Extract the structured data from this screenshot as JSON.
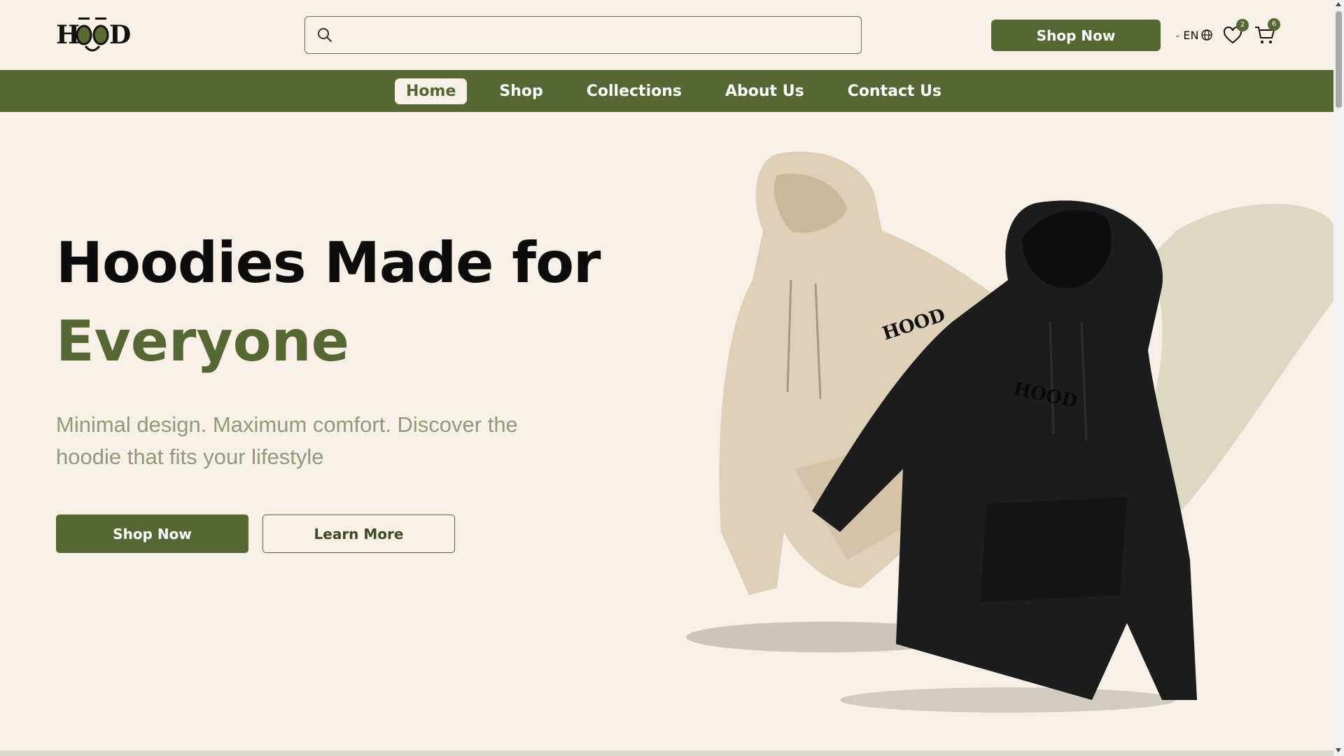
{
  "brand": {
    "logo_text": "HOOD",
    "colors": {
      "primary": "#566832",
      "background": "#f8f0e6",
      "muted_text": "#8f9a78"
    }
  },
  "header": {
    "search": {
      "placeholder": "",
      "value": "",
      "icon": "search-icon"
    },
    "shop_now_label": "Shop Now",
    "language": "EN",
    "wishlist_count": "2",
    "cart_count": "6"
  },
  "nav": {
    "items": [
      {
        "label": "Home",
        "active": true
      },
      {
        "label": "Shop",
        "active": false
      },
      {
        "label": "Collections",
        "active": false
      },
      {
        "label": "About Us",
        "active": false
      },
      {
        "label": "Contact Us",
        "active": false
      }
    ]
  },
  "hero": {
    "title_line1": "Hoodies Made for",
    "title_line2": "Everyone",
    "subtitle": "Minimal design. Maximum comfort. Discover the hoodie that fits your lifestyle",
    "primary_cta": "Shop Now",
    "secondary_cta": "Learn More",
    "image_logo_text": "HOOD"
  }
}
